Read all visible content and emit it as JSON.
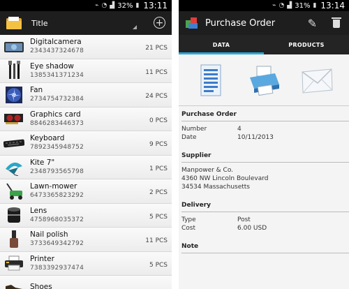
{
  "left": {
    "status": {
      "battery": "32%",
      "time": "13:11"
    },
    "header": {
      "title": "Title"
    },
    "items": [
      {
        "name": "Digitalcamera",
        "code": "2343437324678",
        "qty": "21 PCS",
        "icon": "camera-icon"
      },
      {
        "name": "Eye shadow",
        "code": "1385341371234",
        "qty": "11 PCS",
        "icon": "makeup-brushes-icon"
      },
      {
        "name": "Fan",
        "code": "2734754732384",
        "qty": "24 PCS",
        "icon": "fan-icon"
      },
      {
        "name": "Graphics card",
        "code": "8846283446373",
        "qty": "0 PCS",
        "icon": "graphics-card-icon"
      },
      {
        "name": "Keyboard",
        "code": "7892345948752",
        "qty": "9 PCS",
        "icon": "keyboard-icon"
      },
      {
        "name": "Kite 7\"",
        "code": "2348793565798",
        "qty": "1 PCS",
        "icon": "kite-icon"
      },
      {
        "name": "Lawn-mower",
        "code": "6473365823292",
        "qty": "2 PCS",
        "icon": "lawn-mower-icon"
      },
      {
        "name": "Lens",
        "code": "4758968035372",
        "qty": "5 PCS",
        "icon": "lens-icon"
      },
      {
        "name": "Nail polish",
        "code": "3733649342792",
        "qty": "11 PCS",
        "icon": "nail-polish-icon"
      },
      {
        "name": "Printer",
        "code": "7383392937474",
        "qty": "5 PCS",
        "icon": "printer-icon"
      },
      {
        "name": "Shoes",
        "code": "",
        "qty": "",
        "icon": "shoes-icon"
      }
    ]
  },
  "right": {
    "status": {
      "battery": "31%",
      "time": "13:14"
    },
    "header": {
      "title": "Purchase Order"
    },
    "tabs": [
      "DATA",
      "PRODUCTS"
    ],
    "sections": {
      "po": {
        "title": "Purchase Order",
        "number_label": "Number",
        "number_value": "4",
        "date_label": "Date",
        "date_value": "10/11/2013"
      },
      "supplier": {
        "title": "Supplier",
        "line1": "Manpower & Co.",
        "line2": "4360 NW Lincoln Boulevard",
        "line3": "34534 Massachusetts"
      },
      "delivery": {
        "title": "Delivery",
        "type_label": "Type",
        "type_value": "Post",
        "cost_label": "Cost",
        "cost_value": "6.00 USD"
      },
      "note": {
        "title": "Note"
      }
    }
  },
  "colors": {
    "accent": "#2aa7d8",
    "actionbar": "#1e1e1e"
  }
}
